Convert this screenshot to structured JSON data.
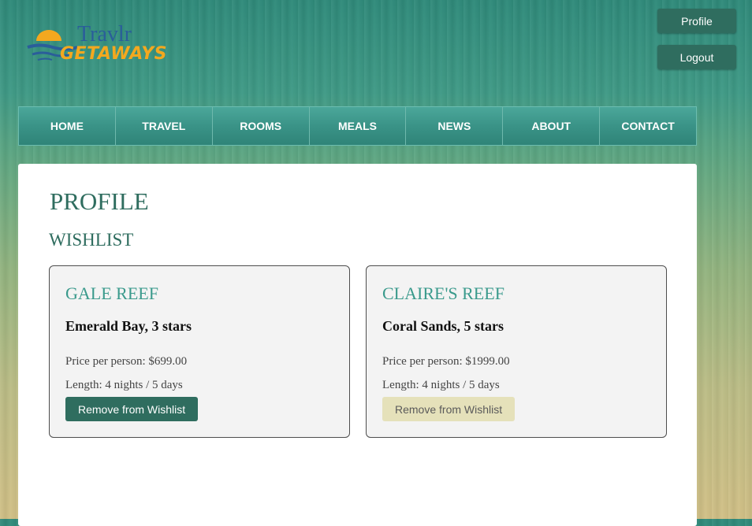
{
  "header": {
    "logo_line1": "Travlr",
    "logo_line2": "GETAWAYS",
    "profile_label": "Profile",
    "logout_label": "Logout"
  },
  "nav": {
    "items": [
      "HOME",
      "TRAVEL",
      "ROOMS",
      "MEALS",
      "NEWS",
      "ABOUT",
      "CONTACT"
    ]
  },
  "main": {
    "title": "PROFILE",
    "section": "WISHLIST",
    "cards": [
      {
        "name": "GALE REEF",
        "resort": "Emerald Bay, 3 stars",
        "price": "Price per person: $699.00",
        "length": "Length: 4 nights / 5 days",
        "button": "Remove from Wishlist"
      },
      {
        "name": "CLAIRE'S REEF",
        "resort": "Coral Sands, 5 stars",
        "price": "Price per person: $1999.00",
        "length": "Length: 4 nights / 5 days",
        "button": "Remove from Wishlist"
      }
    ]
  },
  "colors": {
    "brand_dark": "#2f6d5f",
    "brand_teal": "#3a9a8c",
    "logo_blue": "#2a5e9a",
    "logo_orange": "#f3a81f",
    "remove_button_light": "#e5e1ba"
  }
}
